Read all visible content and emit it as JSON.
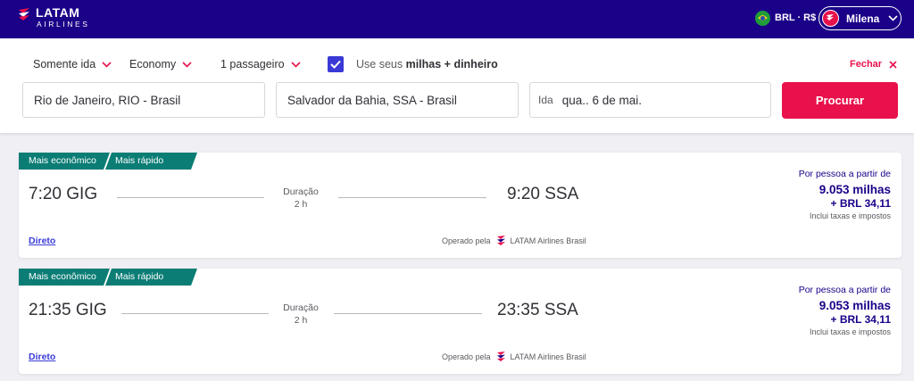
{
  "header": {
    "brand": {
      "name": "LATAM",
      "sub": "AIRLINES"
    },
    "currency": "BRL · R$",
    "user": "Milena",
    "colors": {
      "bar": "#1b0088",
      "accent": "#e8114b"
    }
  },
  "search": {
    "trip_type": "Somente ida",
    "cabin": "Economy",
    "passengers": "1 passageiro",
    "miles_checkbox": {
      "checked": true,
      "label_prefix": "Use seus",
      "label_bold": "milhas + dinheiro"
    },
    "close_label": "Fechar",
    "origin": "Rio de Janeiro, RIO - Brasil",
    "destination": "Salvador da Bahia, SSA - Brasil",
    "date_prefix": "Ida",
    "date_value": "qua.. 6 de mai.",
    "search_button": "Procurar"
  },
  "flights": [
    {
      "tag_cheapest": "Mais econômico",
      "tag_fastest": "Mais rápido",
      "depart": "7:20 GIG",
      "arrive": "9:20 SSA",
      "duration_label": "Duração",
      "duration_value": "2 h",
      "price_head": "Por pessoa a partir de",
      "price_miles": "9.053 milhas",
      "price_cash": "+ BRL 34,11",
      "price_note": "Inclui taxas e impostos",
      "stops": "Direto",
      "operated_prefix": "Operado pela",
      "operator": "LATAM Airlines Brasil"
    },
    {
      "tag_cheapest": "Mais econômico",
      "tag_fastest": "Mais rápido",
      "depart": "21:35 GIG",
      "arrive": "23:35 SSA",
      "duration_label": "Duração",
      "duration_value": "2 h",
      "price_head": "Por pessoa a partir de",
      "price_miles": "9.053 milhas",
      "price_cash": "+ BRL 34,11",
      "price_note": "Inclui taxas e impostos",
      "stops": "Direto",
      "operated_prefix": "Operado pela",
      "operator": "LATAM Airlines Brasil"
    }
  ]
}
